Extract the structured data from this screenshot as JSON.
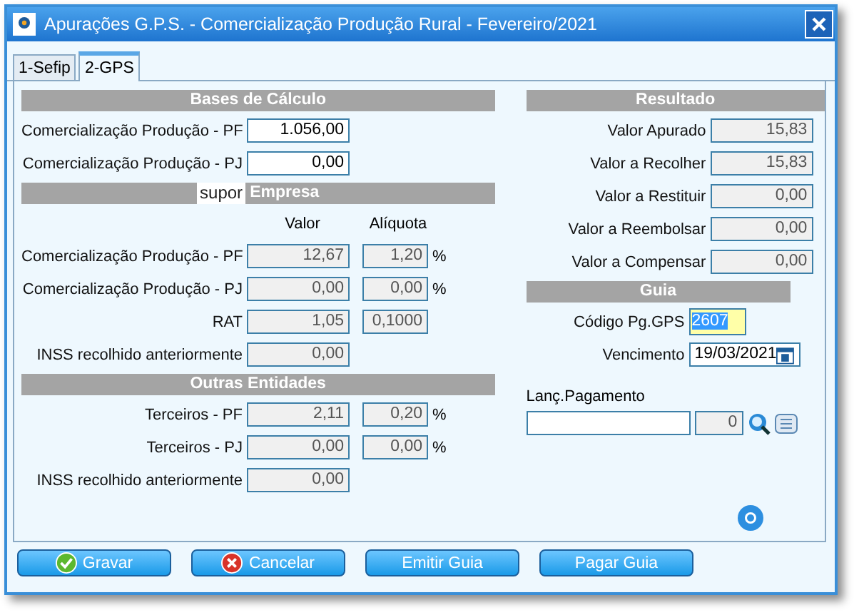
{
  "window": {
    "title": "Apurações G.P.S. - Comercialização Produção Rural - Fevereiro/2021"
  },
  "tabs": [
    {
      "label": "1-Sefip",
      "selected": false
    },
    {
      "label": "2-GPS",
      "selected": true
    }
  ],
  "bases": {
    "title": "Bases de Cálculo",
    "rows": [
      {
        "label": "Comercialização Produção - PF",
        "value": "1.056,00"
      },
      {
        "label": "Comercialização Produção - PJ",
        "value": "0,00"
      }
    ]
  },
  "empresa": {
    "title": "Empresa",
    "tooltip": "supor",
    "columns": [
      "Valor",
      "Alíquota"
    ],
    "rows": [
      {
        "label": "Comercialização Produção - PF",
        "value": "12,67",
        "rate": "1,20",
        "unit": "%"
      },
      {
        "label": "Comercialização Produção - PJ",
        "value": "0,00",
        "rate": "0,00",
        "unit": "%"
      },
      {
        "label": "RAT",
        "value": "1,05",
        "rate": "0,1000"
      },
      {
        "label": "INSS recolhido anteriormente",
        "value": "0,00"
      }
    ]
  },
  "outras": {
    "title": "Outras Entidades",
    "rows": [
      {
        "label": "Terceiros - PF",
        "value": "2,11",
        "rate": "0,20",
        "unit": "%"
      },
      {
        "label": "Terceiros - PJ",
        "value": "0,00",
        "rate": "0,00",
        "unit": "%"
      },
      {
        "label": "INSS recolhido anteriormente",
        "value": "0,00"
      }
    ]
  },
  "resultado": {
    "title": "Resultado",
    "rows": [
      {
        "label": "Valor Apurado",
        "value": "15,83"
      },
      {
        "label": "Valor a Recolher",
        "value": "15,83"
      },
      {
        "label": "Valor a Restituir",
        "value": "0,00"
      },
      {
        "label": "Valor a Reembolsar",
        "value": "0,00"
      },
      {
        "label": "Valor a Compensar",
        "value": "0,00"
      }
    ]
  },
  "guia": {
    "title": "Guia",
    "codigo": {
      "label": "Código Pg.GPS",
      "value": "2607",
      "text_selected": true
    },
    "vencimento": {
      "label": "Vencimento",
      "value": "19/03/2021"
    }
  },
  "lancamento": {
    "label": "Lanç.Pagamento",
    "number": "0"
  },
  "buttons": [
    {
      "label": "Gravar",
      "kind": "confirm"
    },
    {
      "label": "Cancelar",
      "kind": "cancel"
    },
    {
      "label": "Emitir Guia",
      "kind": "plain"
    },
    {
      "label": "Pagar Guia",
      "kind": "plain"
    }
  ]
}
